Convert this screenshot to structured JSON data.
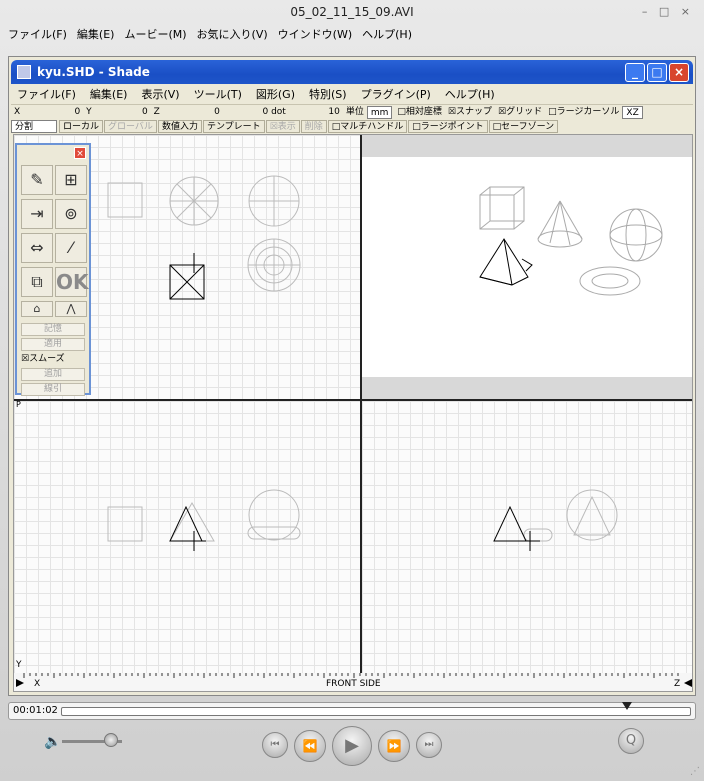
{
  "player": {
    "title": "05_02_11_15_09.AVI",
    "window_controls": "– □ ×",
    "menu": [
      "ファイル(F)",
      "編集(E)",
      "ムービー(M)",
      "お気に入り(V)",
      "ウインドウ(W)",
      "ヘルプ(H)"
    ],
    "timecode": "00:01:02",
    "progress_fraction": 0.9,
    "volume_fraction": 0.82,
    "icons": [
      "volume-icon",
      "go-to-start-icon",
      "rewind-icon",
      "play-icon",
      "fast-forward-icon",
      "go-to-end-icon",
      "quicktime-logo-icon",
      "apple-icon",
      "resize-grip-icon"
    ]
  },
  "shade": {
    "title": "kyu.SHD - Shade",
    "window_buttons": [
      "_",
      "□",
      "×"
    ],
    "menu": [
      "ファイル(F)",
      "編集(E)",
      "表示(V)",
      "ツール(T)",
      "図形(G)",
      "特別(S)",
      "プラグイン(P)",
      "ヘルプ(H)"
    ],
    "coords": {
      "x_label": "X",
      "x_value": "0",
      "y_label": "Y",
      "y_value": "0",
      "z_label": "Z",
      "z_value": "0",
      "dot_value": "0 dot",
      "dot_count": "10"
    },
    "unit_label": "単位",
    "unit_value": "mm",
    "toggles_row1": [
      "□相対座標",
      "☒スナップ",
      "☒グリッド",
      "□ラージカーソル"
    ],
    "plane_value": "XZ",
    "row2": {
      "split": "分割",
      "local": "ローカル",
      "global": "グローバル",
      "numeric": "数値入力",
      "template": "テンプレート",
      "show": "☒表示",
      "delete": "削除",
      "multihandle": "□マルチハンドル",
      "largepoint": "□ラージポイント",
      "safezone": "□セーフゾーン"
    },
    "palette": {
      "close": "×",
      "tools": [
        "pencil-tool-icon",
        "hierarchy-tool-icon",
        "move-tool-icon",
        "cylinder-tool-icon",
        "scale-tool-icon",
        "line-tool-icon",
        "copy-tool-icon"
      ],
      "ok_label": "OK",
      "buttons": [
        "記憶",
        "適用"
      ],
      "smooth": "☒スムーズ",
      "buttons2": [
        "追加",
        "線引"
      ]
    },
    "ruler": {
      "x_label": "X",
      "center_label": "FRONT SIDE",
      "z_label": "Z",
      "y_label": "Y",
      "p_label": "P"
    }
  }
}
